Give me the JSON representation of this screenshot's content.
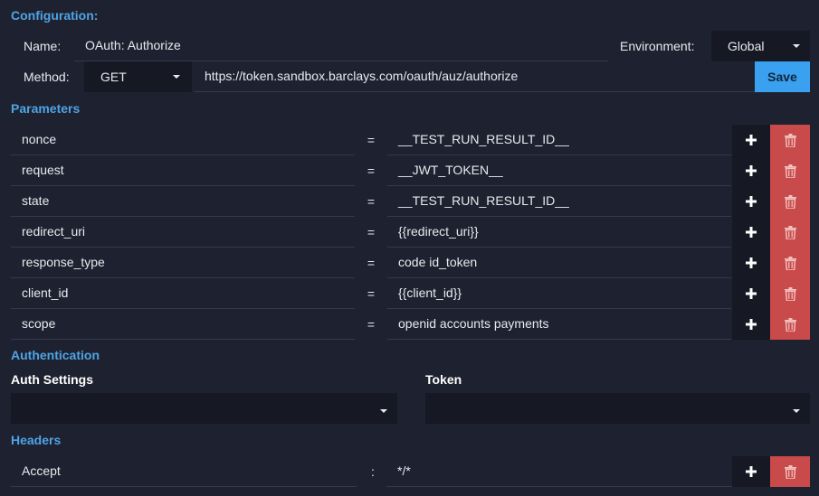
{
  "configuration": {
    "title": "Configuration:",
    "name_label": "Name:",
    "name_value": "OAuth: Authorize",
    "environment_label": "Environment:",
    "environment_value": "Global",
    "method_label": "Method:",
    "method_value": "GET",
    "url_value": "https://token.sandbox.barclays.com/oauth/auz/authorize",
    "save_label": "Save"
  },
  "parameters": {
    "title": "Parameters",
    "separator": "=",
    "rows": [
      {
        "key": "nonce",
        "value": "__TEST_RUN_RESULT_ID__"
      },
      {
        "key": "request",
        "value": "__JWT_TOKEN__"
      },
      {
        "key": "state",
        "value": "__TEST_RUN_RESULT_ID__"
      },
      {
        "key": "redirect_uri",
        "value": "{{redirect_uri}}"
      },
      {
        "key": "response_type",
        "value": "code id_token"
      },
      {
        "key": "client_id",
        "value": "{{client_id}}"
      },
      {
        "key": "scope",
        "value": "openid accounts payments"
      }
    ]
  },
  "authentication": {
    "title": "Authentication",
    "auth_settings_label": "Auth Settings",
    "auth_settings_value": "",
    "token_label": "Token",
    "token_value": ""
  },
  "headers": {
    "title": "Headers",
    "separator": ":",
    "rows": [
      {
        "key": "Accept",
        "value": "*/*"
      }
    ]
  },
  "icons": {
    "add": "plus-icon",
    "delete": "trash-icon",
    "dropdown": "chevron-down-icon"
  },
  "colors": {
    "background": "#1e2230",
    "section_title": "#4fa3e6",
    "save_button": "#3aa0f0",
    "delete_button": "#c94a4a",
    "dark_control": "#161924"
  }
}
